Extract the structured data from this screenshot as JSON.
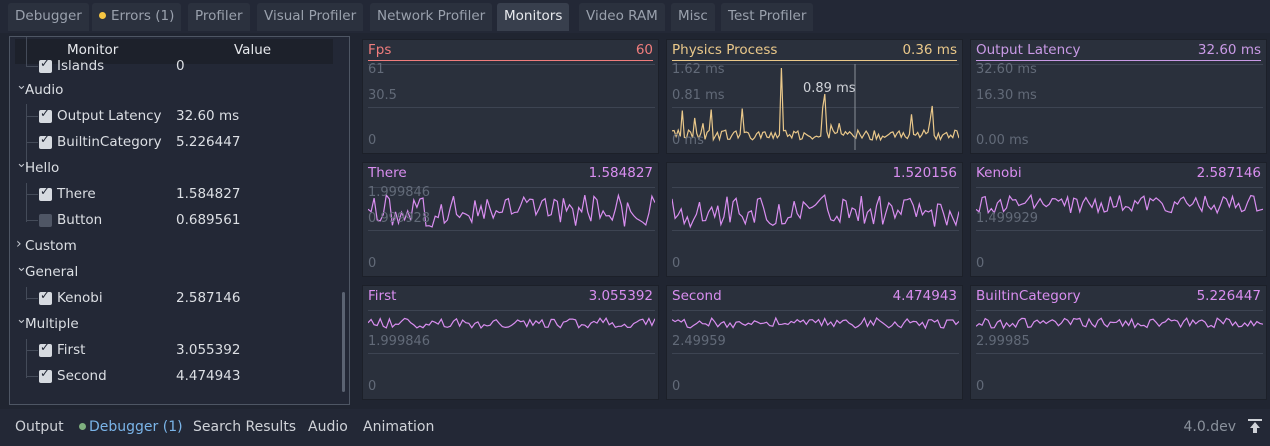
{
  "tabs": [
    {
      "label": "Debugger",
      "active": false
    },
    {
      "label": "Errors (1)",
      "active": false,
      "dot": "#f5c542"
    },
    {
      "label": "Profiler",
      "active": false
    },
    {
      "label": "Visual Profiler",
      "active": false
    },
    {
      "label": "Network Profiler",
      "active": false
    },
    {
      "label": "Monitors",
      "active": true
    },
    {
      "label": "Video RAM",
      "active": false
    },
    {
      "label": "Misc",
      "active": false
    },
    {
      "label": "Test Profiler",
      "active": false
    }
  ],
  "tree": {
    "header": {
      "monitor": "Monitor",
      "value": "Value"
    },
    "rows": [
      {
        "kind": "item",
        "label": "Islands",
        "value": "0",
        "checked": true,
        "partial": true
      },
      {
        "kind": "group",
        "label": "Audio",
        "expanded": true
      },
      {
        "kind": "item",
        "label": "Output Latency",
        "value": "32.60 ms",
        "checked": true
      },
      {
        "kind": "item",
        "label": "BuiltinCategory",
        "value": "5.226447",
        "checked": true
      },
      {
        "kind": "group",
        "label": "Hello",
        "expanded": true
      },
      {
        "kind": "item",
        "label": "There",
        "value": "1.584827",
        "checked": true
      },
      {
        "kind": "item",
        "label": "Button",
        "value": "0.689561",
        "checked": false
      },
      {
        "kind": "group",
        "label": "Custom",
        "expanded": false
      },
      {
        "kind": "group",
        "label": "General",
        "expanded": true
      },
      {
        "kind": "item",
        "label": "Kenobi",
        "value": "2.587146",
        "checked": true
      },
      {
        "kind": "group",
        "label": "Multiple",
        "expanded": true
      },
      {
        "kind": "item",
        "label": "First",
        "value": "3.055392",
        "checked": true
      },
      {
        "kind": "item",
        "label": "Second",
        "value": "4.474943",
        "checked": true
      }
    ]
  },
  "graphs": [
    {
      "name": "Fps",
      "value": "60",
      "color": "#f07d7d",
      "labels": [
        "61",
        "30.5",
        "0"
      ],
      "style": "flat"
    },
    {
      "name": "Physics Process",
      "value": "0.36 ms",
      "color": "#eac88a",
      "labels": [
        "1.62 ms",
        "0.81 ms",
        "0 ms"
      ],
      "style": "spiky",
      "marker": "0.89 ms"
    },
    {
      "name": "Output Latency",
      "value": "32.60 ms",
      "color": "#c99ae6",
      "labels": [
        "32.60 ms",
        "16.30 ms",
        "0.00 ms"
      ],
      "style": "flat"
    },
    {
      "name": "There",
      "value": "1.584827",
      "color": "#d98ef0",
      "labels": [
        "1.999846",
        "0.999928",
        "0"
      ],
      "style": "noise-big"
    },
    {
      "name": "",
      "value": "1.520156",
      "color": "#d98ef0",
      "labels": [
        "",
        "",
        "0"
      ],
      "style": "noise-big"
    },
    {
      "name": "Kenobi",
      "value": "2.587146",
      "color": "#d98ef0",
      "labels": [
        "",
        "1.499929",
        "0"
      ],
      "style": "noise-mid"
    },
    {
      "name": "First",
      "value": "3.055392",
      "color": "#d98ef0",
      "labels": [
        "",
        "1.999846",
        "0"
      ],
      "style": "noise-small"
    },
    {
      "name": "Second",
      "value": "4.474943",
      "color": "#d98ef0",
      "labels": [
        "",
        "2.49959",
        "0"
      ],
      "style": "noise-small"
    },
    {
      "name": "BuiltinCategory",
      "value": "5.226447",
      "color": "#d98ef0",
      "labels": [
        "",
        "2.99985",
        "0"
      ],
      "style": "noise-small"
    }
  ],
  "bottom": {
    "tabs": [
      {
        "label": "Output"
      },
      {
        "label": "Debugger (1)",
        "dot": "#7fb07f",
        "highlight": "#7ab4e8"
      },
      {
        "label": "Search Results"
      },
      {
        "label": "Audio"
      },
      {
        "label": "Animation"
      }
    ],
    "version": "4.0.dev",
    "pin_icon": "pin-panel-icon"
  }
}
